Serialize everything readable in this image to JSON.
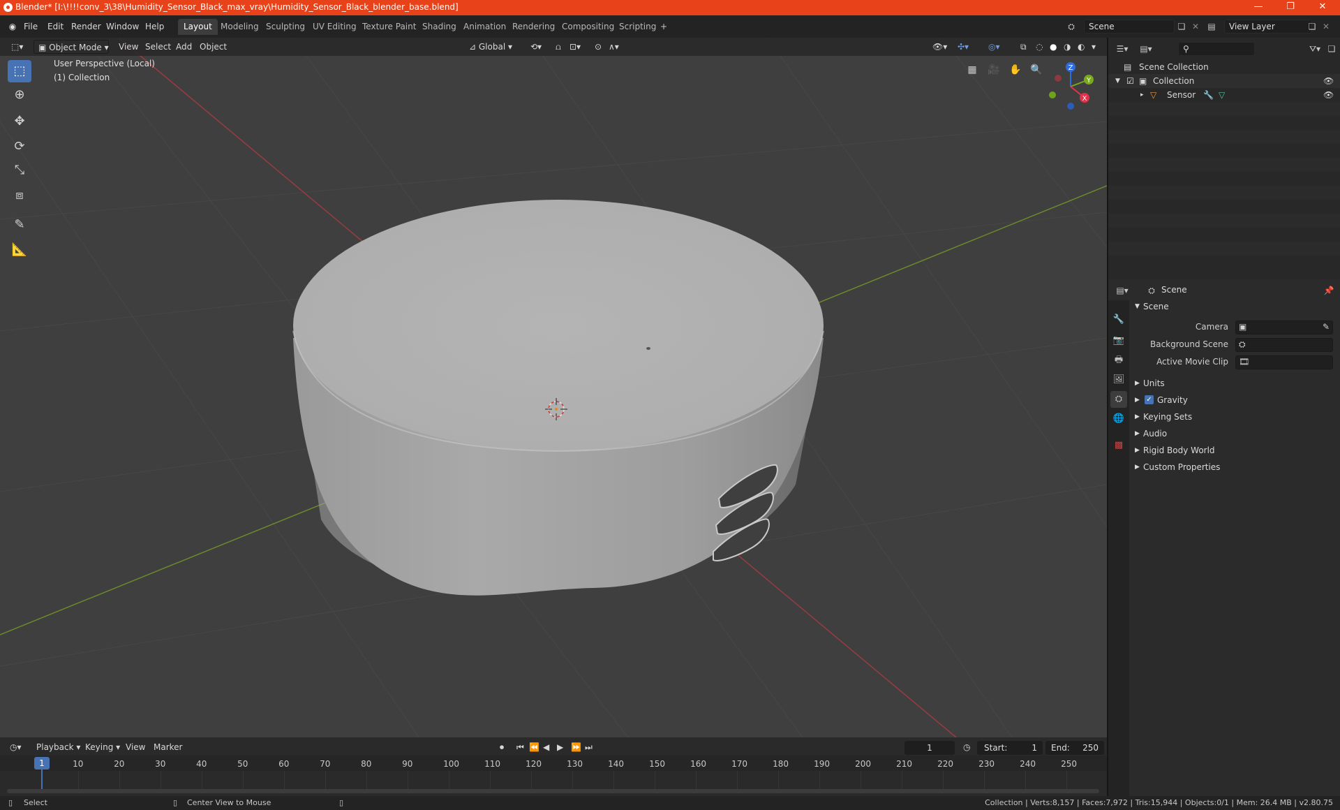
{
  "window": {
    "title": "Blender* [I:\\!!!!conv_3\\38\\Humidity_Sensor_Black_max_vray\\Humidity_Sensor_Black_blender_base.blend]",
    "minimize": "—",
    "restore": "❐",
    "close": "✕"
  },
  "menus": [
    "File",
    "Edit",
    "Render",
    "Window",
    "Help"
  ],
  "workspaces": [
    {
      "label": "Layout",
      "active": true
    },
    {
      "label": "Modeling"
    },
    {
      "label": "Sculpting"
    },
    {
      "label": "UV Editing"
    },
    {
      "label": "Texture Paint"
    },
    {
      "label": "Shading"
    },
    {
      "label": "Animation"
    },
    {
      "label": "Rendering"
    },
    {
      "label": "Compositing"
    },
    {
      "label": "Scripting"
    }
  ],
  "add_workspace": "+",
  "scene_field": "Scene",
  "view_layer_field": "View Layer",
  "viewport_header": {
    "mode": "Object Mode",
    "view": "View",
    "select": "Select",
    "add": "Add",
    "object": "Object",
    "orientation": "Global"
  },
  "viewport_overlay": {
    "perspective": "User Perspective (Local)",
    "collection": "(1) Collection"
  },
  "gizmo": {
    "z": "Z",
    "y": "Y",
    "x": "X",
    "z_color": "#2f6ce0",
    "y_color": "#7aa81e",
    "x_color": "#e0334a"
  },
  "outliner": {
    "root": "Scene Collection",
    "collection": "Collection",
    "object": "Sensor"
  },
  "properties": {
    "header": "Scene",
    "section": "Scene",
    "camera_label": "Camera",
    "background_scene_label": "Background Scene",
    "active_movie_clip_label": "Active Movie Clip",
    "panels": [
      {
        "label": "Units",
        "checkbox": false
      },
      {
        "label": "Gravity",
        "checkbox": true
      },
      {
        "label": "Keying Sets",
        "checkbox": false
      },
      {
        "label": "Audio",
        "checkbox": false
      },
      {
        "label": "Rigid Body World",
        "checkbox": false
      },
      {
        "label": "Custom Properties",
        "checkbox": false
      }
    ]
  },
  "timeline": {
    "playback": "Playback",
    "keying": "Keying",
    "view": "View",
    "marker": "Marker",
    "current_frame": "1",
    "start_label": "Start:",
    "start": "1",
    "end_label": "End:",
    "end": "250",
    "ticks": [
      "10",
      "20",
      "30",
      "40",
      "50",
      "60",
      "70",
      "80",
      "90",
      "100",
      "110",
      "120",
      "130",
      "140",
      "150",
      "160",
      "170",
      "180",
      "190",
      "200",
      "210",
      "220",
      "230",
      "240",
      "250"
    ],
    "playhead": "1"
  },
  "statusbar": {
    "select": "Select",
    "center_view": "Center View to Mouse",
    "stats": "Collection | Verts:8,157 | Faces:7,972 | Tris:15,944 | Objects:0/1 | Mem: 26.4 MB | v2.80.75"
  },
  "accent_color": "#4772b3",
  "titlebar_color": "#e8421a"
}
